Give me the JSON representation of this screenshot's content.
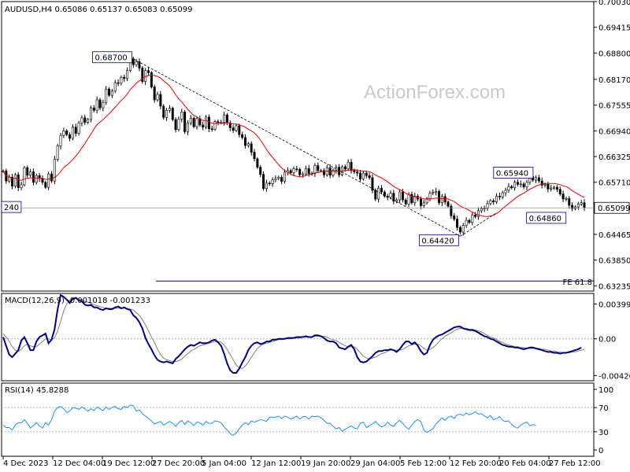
{
  "chart_data": [
    {
      "type": "candlestick",
      "title": "AUDUSD,H4",
      "ohlc_readout": [
        "0.65086",
        "0.65137",
        "0.65083",
        "0.65099"
      ],
      "y_ticks": [
        "0.70030",
        "0.69415",
        "0.68800",
        "0.68170",
        "0.67555",
        "0.66940",
        "0.66325",
        "0.65710",
        "0.65099",
        "0.64465",
        "0.63850",
        "0.63235"
      ],
      "ylim": [
        0.6311,
        0.7003
      ],
      "last_price": "0.65099",
      "annotations": [
        {
          "text": "0.68700",
          "value": 0.687
        },
        {
          "text": "0.65940",
          "value": 0.6594
        },
        {
          "text": "0.64860",
          "value": 0.6486
        },
        {
          "text": "0.64420",
          "value": 0.6442
        },
        {
          "text": "240",
          "value": 0.6512
        }
      ],
      "fibo_label": "FE 61.8",
      "fibo_level": 0.6335,
      "moving_average_color": "#e00000",
      "candle_color": "#000000",
      "trendline": [
        [
          0.687,
          0.6442
        ]
      ],
      "close_series": [
        0.6598,
        0.6574,
        0.6583,
        0.6562,
        0.6589,
        0.6558,
        0.6565,
        0.6606,
        0.6588,
        0.6596,
        0.6571,
        0.6587,
        0.658,
        0.6571,
        0.6559,
        0.6591,
        0.6574,
        0.6626,
        0.6658,
        0.6683,
        0.6694,
        0.6685,
        0.6676,
        0.6703,
        0.6688,
        0.6713,
        0.6725,
        0.6714,
        0.6721,
        0.6749,
        0.6743,
        0.6768,
        0.6749,
        0.6762,
        0.6794,
        0.6779,
        0.6789,
        0.6809,
        0.6808,
        0.6822,
        0.6819,
        0.6838,
        0.6866,
        0.6852,
        0.6859,
        0.6844,
        0.6812,
        0.6838,
        0.6833,
        0.6799,
        0.6768,
        0.6781,
        0.6753,
        0.6726,
        0.6743,
        0.6748,
        0.6721,
        0.6697,
        0.6722,
        0.6739,
        0.6692,
        0.6713,
        0.6724,
        0.6704,
        0.6723,
        0.6708,
        0.6703,
        0.6727,
        0.6699,
        0.6698,
        0.6716,
        0.6714,
        0.6714,
        0.6732,
        0.6713,
        0.6701,
        0.6695,
        0.6706,
        0.6685,
        0.6678,
        0.6659,
        0.6663,
        0.6643,
        0.6627,
        0.6607,
        0.659,
        0.6556,
        0.6569,
        0.6568,
        0.6577,
        0.658,
        0.6583,
        0.6573,
        0.6595,
        0.6599,
        0.6594,
        0.6603,
        0.6602,
        0.6589,
        0.6591,
        0.6604,
        0.6592,
        0.6592,
        0.6611,
        0.6599,
        0.6599,
        0.6589,
        0.6606,
        0.6588,
        0.66,
        0.6607,
        0.6589,
        0.6608,
        0.6603,
        0.6619,
        0.6599,
        0.6596,
        0.6593,
        0.6579,
        0.6593,
        0.6587,
        0.6582,
        0.6552,
        0.6531,
        0.6557,
        0.6548,
        0.6538,
        0.6535,
        0.6545,
        0.6526,
        0.6529,
        0.6548,
        0.6529,
        0.6519,
        0.6542,
        0.6522,
        0.6538,
        0.6531,
        0.6515,
        0.6522,
        0.6532,
        0.6545,
        0.6547,
        0.6549,
        0.6522,
        0.6537,
        0.6524,
        0.6514,
        0.6491,
        0.6483,
        0.6463,
        0.6452,
        0.6468,
        0.648,
        0.6475,
        0.6493,
        0.6489,
        0.6503,
        0.6508,
        0.6509,
        0.652,
        0.6527,
        0.6524,
        0.6538,
        0.6536,
        0.6546,
        0.6552,
        0.6561,
        0.6558,
        0.6571,
        0.6566,
        0.6567,
        0.656,
        0.6571,
        0.6585,
        0.6576,
        0.6582,
        0.6574,
        0.6564,
        0.6566,
        0.6555,
        0.6557,
        0.6559,
        0.6554,
        0.6543,
        0.6531,
        0.6532,
        0.6516,
        0.6508,
        0.6512,
        0.6519,
        0.6522,
        0.651
      ]
    },
    {
      "type": "line",
      "title": "MACD(12,26,9) -0.001018 -0.001233",
      "y_ticks": [
        "0.00399",
        "0.00",
        "-0.004206"
      ],
      "ylim": [
        -0.0048,
        0.0052
      ],
      "series": [
        {
          "color": "#000080",
          "values": [
            0.0002,
            -0.0008,
            -0.0018,
            -0.0021,
            -0.0017,
            -0.0013,
            -0.0002,
            0.0002,
            -0.0005,
            -0.0013,
            -0.0013,
            -0.0003,
            0.0002,
            0.0004,
            0.0006,
            -0.0005,
            -0.0001,
            0.0011,
            0.0034,
            0.005,
            0.0048,
            0.0045,
            0.0041,
            0.0046,
            0.0047,
            0.0044,
            0.0043,
            0.0039,
            0.0038,
            0.0039,
            0.0036,
            0.0036,
            0.0034,
            0.0033,
            0.0035,
            0.0034,
            0.0034,
            0.0036,
            0.0037,
            0.0035,
            0.0036,
            0.0034,
            0.0033,
            0.0027,
            0.0024,
            0.0019,
            0.0012,
            0.0001,
            -0.0006,
            -0.0012,
            -0.0019,
            -0.0024,
            -0.0026,
            -0.0027,
            -0.0026,
            -0.0027,
            -0.0028,
            -0.0023,
            -0.002,
            -0.0016,
            -0.0012,
            -0.0009,
            -0.0007,
            -0.0008,
            -0.0006,
            -0.0004,
            -0.0005,
            -0.0005,
            -0.0004,
            -0.0002,
            -0.0001,
            -0.0004,
            -0.0008,
            -0.0017,
            -0.0028,
            -0.0036,
            -0.0039,
            -0.0039,
            -0.0034,
            -0.0027,
            -0.0021,
            -0.0013,
            -0.0008,
            -0.0005,
            -0.0004,
            -0.0006,
            -0.0005,
            -0.0003,
            -0.0003,
            -0.0001,
            -0.0001,
            -0.0,
            0.0,
            0.0,
            0.0001,
            0.0001,
            0.0001,
            0.0002,
            0.0002,
            0.0002,
            0.0003,
            0.0002,
            0.0002,
            0.0004,
            0.0004,
            0.0003,
            0.0001,
            -0.0002,
            -0.0003,
            -0.0003,
            -0.0005,
            -0.001,
            -0.0011,
            -0.0012,
            -0.0009,
            -0.0007,
            -0.0012,
            -0.0021,
            -0.0026,
            -0.0027,
            -0.0026,
            -0.0023,
            -0.002,
            -0.0016,
            -0.0014,
            -0.0014,
            -0.0013,
            -0.0013,
            -0.0012,
            -0.0013,
            -0.0015,
            -0.0012,
            -0.0007,
            -0.0003,
            -0.0003,
            -0.0006,
            -0.0004,
            -0.0008,
            -0.0014,
            -0.0018,
            -0.0016,
            -0.0007,
            -0.0001,
            0.0002,
            0.0004,
            0.0005,
            0.0007,
            0.0009,
            0.0011,
            0.0013,
            0.0014,
            0.0014,
            0.0012,
            0.0011,
            0.001,
            0.001,
            0.0009,
            0.0007,
            0.0005,
            0.0003,
            0.0002,
            0.0,
            -0.0001,
            -0.0003,
            -0.0005,
            -0.0007,
            -0.0008,
            -0.0009,
            -0.0009,
            -0.001,
            -0.001,
            -0.0011,
            -0.0012,
            -0.0011,
            -0.001,
            -0.001,
            -0.0011,
            -0.0012,
            -0.0013,
            -0.0014,
            -0.0015,
            -0.0015,
            -0.0016,
            -0.0016,
            -0.0017,
            -0.0016,
            -0.0016,
            -0.0015,
            -0.0014,
            -0.0013,
            -0.0012,
            -0.001
          ]
        },
        {
          "color": "#808080",
          "values": [
            0.0006,
            0.0002,
            -0.0003,
            -0.0009,
            -0.0013,
            -0.0014,
            -0.0012,
            -0.0008,
            -0.0006,
            -0.0008,
            -0.0009,
            -0.0009,
            -0.0006,
            -0.0003,
            0.0,
            0.0,
            -0.0001,
            0.0001,
            0.0009,
            0.002,
            0.0032,
            0.004,
            0.0044,
            0.0045,
            0.0046,
            0.0045,
            0.0045,
            0.0043,
            0.0042,
            0.0041,
            0.0039,
            0.0038,
            0.0037,
            0.0036,
            0.0035,
            0.0035,
            0.0035,
            0.0035,
            0.0035,
            0.0035,
            0.0035,
            0.0035,
            0.0034,
            0.0033,
            0.003,
            0.0027,
            0.0022,
            0.0016,
            0.0009,
            0.0002,
            -0.0004,
            -0.0012,
            -0.0018,
            -0.0022,
            -0.0024,
            -0.0025,
            -0.0026,
            -0.0026,
            -0.0025,
            -0.0023,
            -0.002,
            -0.0017,
            -0.0014,
            -0.0012,
            -0.001,
            -0.0008,
            -0.0007,
            -0.0006,
            -0.0005,
            -0.0004,
            -0.0003,
            -0.0003,
            -0.0004,
            -0.0007,
            -0.0012,
            -0.0018,
            -0.0024,
            -0.003,
            -0.0033,
            -0.0034,
            -0.0031,
            -0.0027,
            -0.0021,
            -0.0016,
            -0.0011,
            -0.0008,
            -0.0006,
            -0.0005,
            -0.0004,
            -0.0003,
            -0.0002,
            -0.0001,
            -0.0001,
            -0.0,
            0.0,
            0.0,
            0.0001,
            0.0001,
            0.0001,
            0.0002,
            0.0002,
            0.0002,
            0.0002,
            0.0003,
            0.0003,
            0.0003,
            0.0003,
            0.0002,
            0.0,
            -0.0001,
            -0.0002,
            -0.0004,
            -0.0006,
            -0.0008,
            -0.0009,
            -0.0009,
            -0.0009,
            -0.0012,
            -0.0016,
            -0.002,
            -0.0022,
            -0.0023,
            -0.0022,
            -0.0021,
            -0.0019,
            -0.0017,
            -0.0016,
            -0.0014,
            -0.0013,
            -0.0013,
            -0.0013,
            -0.0013,
            -0.0012,
            -0.001,
            -0.0008,
            -0.0007,
            -0.0006,
            -0.0006,
            -0.0008,
            -0.0011,
            -0.0013,
            -0.0012,
            -0.001,
            -0.0007,
            -0.0003,
            0.0,
            0.0003,
            0.0005,
            0.0007,
            0.0009,
            0.0011,
            0.0012,
            0.0012,
            0.0012,
            0.0011,
            0.0011,
            0.001,
            0.0009,
            0.0008,
            0.0006,
            0.0004,
            0.0002,
            0.0001,
            -0.0001,
            -0.0003,
            -0.0004,
            -0.0006,
            -0.0007,
            -0.0008,
            -0.0009,
            -0.0009,
            -0.001,
            -0.001,
            -0.0011,
            -0.0011,
            -0.0011,
            -0.0011,
            -0.0011,
            -0.0012,
            -0.0012,
            -0.0013,
            -0.0014,
            -0.0014,
            -0.0015,
            -0.0015,
            -0.0016,
            -0.0016,
            -0.0016,
            -0.0015,
            -0.0015,
            -0.0014,
            -0.0013,
            -0.0012
          ]
        }
      ]
    },
    {
      "type": "line",
      "title": "RSI(14) 45.8288",
      "y_ticks": [
        "100",
        "70",
        "30",
        "0"
      ],
      "ylim": [
        0,
        100
      ],
      "levels": [
        70,
        30
      ],
      "series": [
        {
          "color": "#1e90ff",
          "values": [
            41,
            37,
            37,
            33,
            41,
            45,
            45,
            50,
            44,
            36,
            40,
            45,
            40,
            36,
            45,
            41,
            50,
            64,
            70,
            72,
            68,
            62,
            64,
            70,
            69,
            67,
            71,
            68,
            64,
            68,
            65,
            71,
            68,
            65,
            71,
            67,
            70,
            72,
            68,
            67,
            72,
            70,
            74,
            73,
            64,
            66,
            60,
            56,
            52,
            48,
            43,
            45,
            47,
            41,
            44,
            47,
            44,
            39,
            45,
            49,
            42,
            48,
            45,
            40,
            46,
            45,
            41,
            47,
            44,
            44,
            48,
            47,
            45,
            38,
            33,
            27,
            24,
            28,
            35,
            41,
            45,
            42,
            48,
            46,
            48,
            50,
            49,
            47,
            54,
            54,
            54,
            56,
            52,
            56,
            54,
            51,
            53,
            56,
            51,
            55,
            55,
            51,
            56,
            55,
            56,
            53,
            49,
            44,
            44,
            39,
            35,
            37,
            31,
            34,
            37,
            40,
            36,
            35,
            44,
            46,
            37,
            40,
            43,
            47,
            42,
            38,
            40,
            46,
            41,
            39,
            45,
            49,
            44,
            38,
            34,
            41,
            47,
            50,
            47,
            33,
            29,
            32,
            35,
            43,
            48,
            53,
            49,
            54,
            56,
            52,
            58,
            59,
            57,
            61,
            58,
            60,
            63,
            59,
            60,
            56,
            53,
            57,
            50,
            52,
            55,
            49,
            47,
            48,
            42,
            38,
            36,
            41,
            44,
            46,
            40,
            42,
            40
          ]
        }
      ]
    },
    {
      "x_tick_labels": [
        "4 Dec 2023",
        "12 Dec 04:00",
        "19 Dec 12:00",
        "27 Dec 20:00",
        "5 Jan 04:00",
        "12 Jan 12:00",
        "19 Jan 20:00",
        "29 Jan 04:00",
        "5 Feb 12:00",
        "12 Feb 20:00",
        "20 Feb 04:00",
        "27 Feb 12:00"
      ]
    }
  ],
  "watermark": "ActionForex.com"
}
